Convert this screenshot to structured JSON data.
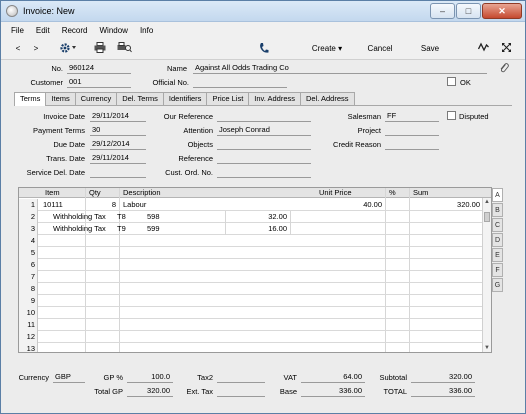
{
  "window": {
    "title": "Invoice: New"
  },
  "menu": [
    "File",
    "Edit",
    "Record",
    "Window",
    "Info"
  ],
  "toolbar": {
    "create": "Create",
    "cancel": "Cancel",
    "save": "Save"
  },
  "header": {
    "no_label": "No.",
    "no_value": "960124",
    "name_label": "Name",
    "name_value": "Against All Odds Trading Co",
    "customer_label": "Customer",
    "customer_value": "001",
    "official_label": "Official No.",
    "official_value": "",
    "ok_label": "OK"
  },
  "tabs": [
    "Terms",
    "Items",
    "Currency",
    "Del. Terms",
    "Identifiers",
    "Price List",
    "Inv. Address",
    "Del. Address"
  ],
  "terms": {
    "invoice_date_label": "Invoice Date",
    "invoice_date": "29/11/2014",
    "payment_terms_label": "Payment Terms",
    "payment_terms": "30",
    "due_date_label": "Due Date",
    "due_date": "29/12/2014",
    "trans_date_label": "Trans. Date",
    "trans_date": "29/11/2014",
    "service_del_label": "Service Del. Date",
    "service_del": "",
    "our_ref_label": "Our Reference",
    "our_ref": "",
    "attention_label": "Attention",
    "attention": "Joseph Conrad",
    "objects_label": "Objects",
    "objects": "",
    "reference_label": "Reference",
    "reference": "",
    "cust_ord_label": "Cust. Ord. No.",
    "cust_ord": "",
    "salesman_label": "Salesman",
    "salesman": "FF",
    "disputed_label": "Disputed",
    "project_label": "Project",
    "project": "",
    "credit_reason_label": "Credit Reason",
    "credit_reason": ""
  },
  "grid": {
    "headers": {
      "item": "Item",
      "qty": "Qty",
      "desc": "Description",
      "price": "Unit Price",
      "pct": "%",
      "sum": "Sum"
    },
    "rows": [
      {
        "n": "1",
        "item": "10111",
        "qty": "8",
        "desc": "Labour",
        "price": "40.00",
        "pct": "",
        "sum": "320.00"
      },
      {
        "n": "2",
        "item": "Withholding Tax",
        "qty": "T8",
        "desc": "598",
        "amount": "32.00"
      },
      {
        "n": "3",
        "item": "Withholding Tax",
        "qty": "T9",
        "desc": "599",
        "amount": "16.00"
      },
      {
        "n": "4"
      },
      {
        "n": "5"
      },
      {
        "n": "6"
      },
      {
        "n": "7"
      },
      {
        "n": "8"
      },
      {
        "n": "9"
      },
      {
        "n": "10"
      },
      {
        "n": "11"
      },
      {
        "n": "12"
      },
      {
        "n": "13"
      }
    ]
  },
  "sidetabs": [
    "A",
    "B",
    "C",
    "D",
    "E",
    "F",
    "G"
  ],
  "footer": {
    "currency_label": "Currency",
    "currency": "GBP",
    "gp_pct_label": "GP %",
    "gp_pct": "100.0",
    "total_gp_label": "Total GP",
    "total_gp": "320.00",
    "tax2_label": "Tax2",
    "tax2": "",
    "ext_tax_label": "Ext. Tax",
    "ext_tax": "",
    "vat_label": "VAT",
    "vat": "64.00",
    "base_label": "Base",
    "base": "336.00",
    "subtotal_label": "Subtotal",
    "subtotal": "320.00",
    "total_label": "TOTAL",
    "total": "336.00"
  }
}
